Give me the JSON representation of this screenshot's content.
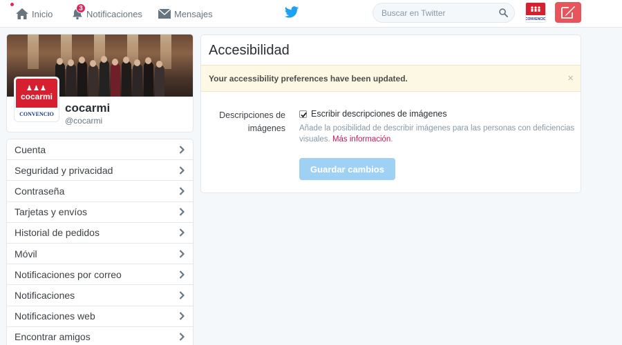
{
  "nav": {
    "home_label": "Inicio",
    "notifications_label": "Notificaciones",
    "notifications_count": "3",
    "messages_label": "Mensajes",
    "search_placeholder": "Buscar en Twitter"
  },
  "profile": {
    "name": "cocarmi",
    "handle": "@cocarmi",
    "avatar_text": "cocarmi",
    "avatar_subtext": "CONVENCIO"
  },
  "menu": {
    "items": [
      {
        "label": "Cuenta"
      },
      {
        "label": "Seguridad y privacidad"
      },
      {
        "label": "Contraseña"
      },
      {
        "label": "Tarjetas y envíos"
      },
      {
        "label": "Historial de pedidos"
      },
      {
        "label": "Móvil"
      },
      {
        "label": "Notificaciones por correo"
      },
      {
        "label": "Notificaciones"
      },
      {
        "label": "Notificaciones web"
      },
      {
        "label": "Encontrar amigos"
      }
    ]
  },
  "panel": {
    "title": "Accesibilidad",
    "alert": "Your accessibility preferences have been updated.",
    "alert_close": "×",
    "field_label": "Descripciones de imágenes",
    "checkbox_label": "Escribir descripciones de imágenes",
    "checkbox_checked": true,
    "help_text": "Añade la posibilidad de describir imágenes para las personas con deficiencias visuales.",
    "help_link": "Más información",
    "help_period": ".",
    "save_label": "Guardar cambios"
  },
  "colors": {
    "accent": "#1da1f2",
    "badge": "#e0245e",
    "compose": "#e8545c",
    "save_disabled": "#9fd1f5",
    "alert_bg": "#fcf8e3",
    "link": "#c2185b"
  }
}
